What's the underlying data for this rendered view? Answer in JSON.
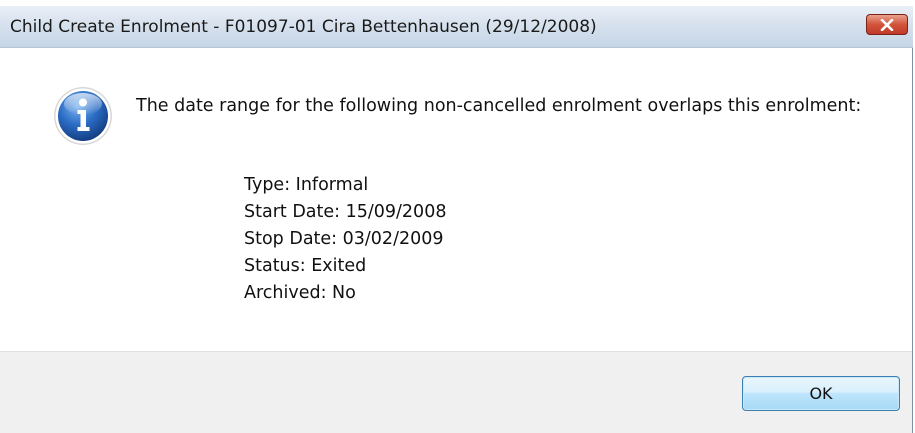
{
  "dialog": {
    "title": "Child Create Enrolment - F01097-01 Cira Bettenhausen (29/12/2008)",
    "close_icon": "close-icon",
    "info_icon": "information-icon",
    "message": "The date range for the following non-cancelled enrolment overlaps this enrolment:",
    "details": [
      "Type: Informal",
      "Start Date: 15/09/2008",
      "Stop Date: 03/02/2009",
      "Status: Exited",
      "Archived: No"
    ],
    "ok_label": "OK"
  },
  "colors": {
    "title_bar": "#d3dfec",
    "close_button": "#c0392b",
    "info_icon": "#1f63b8",
    "footer": "#f0f0f0",
    "ok_button": "#bee6fd"
  }
}
